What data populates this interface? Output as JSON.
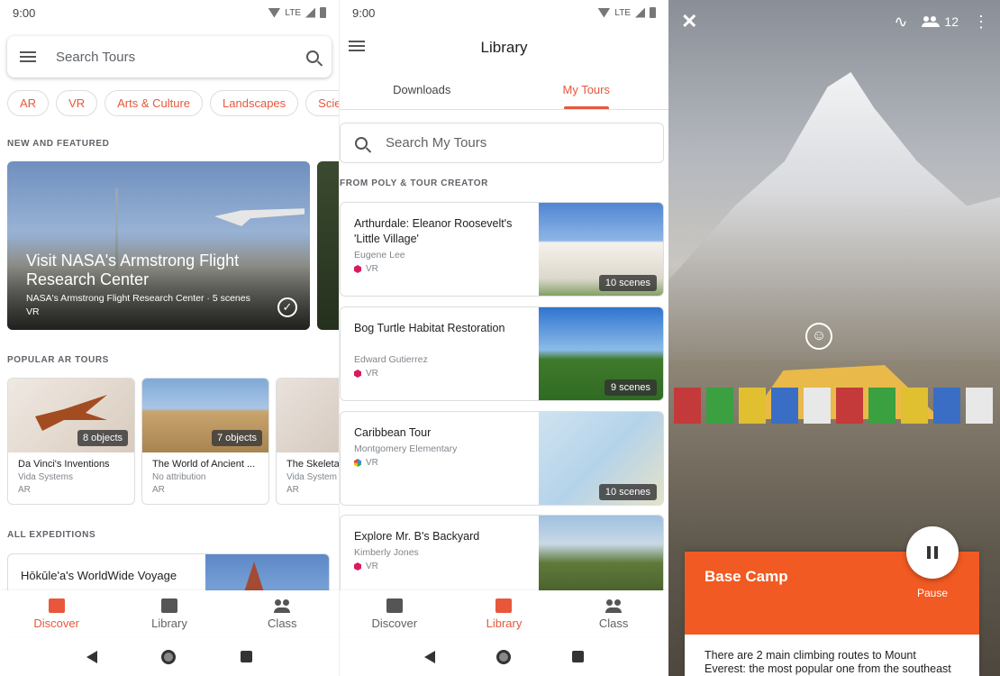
{
  "status": {
    "time": "9:00",
    "network": "LTE"
  },
  "discover": {
    "search_placeholder": "Search Tours",
    "chips": [
      "AR",
      "VR",
      "Arts & Culture",
      "Landscapes",
      "Scien"
    ],
    "new_featured_label": "NEW AND FEATURED",
    "featured": {
      "title": "Visit NASA's Armstrong Flight Research Center",
      "subtitle": "NASA's Armstrong Flight Research Center · 5 scenes",
      "type": "VR"
    },
    "popular_ar_label": "POPULAR AR TOURS",
    "ar_tours": [
      {
        "title": "Da Vinci's Inventions",
        "author": "Vida Systems",
        "type": "AR",
        "count": "8 objects"
      },
      {
        "title": "The World of Ancient ...",
        "author": "No attribution",
        "type": "AR",
        "count": "7 objects"
      },
      {
        "title": "The Skeleta",
        "author": "Vida System",
        "type": "AR",
        "count": ""
      }
    ],
    "all_expeditions_label": "ALL EXPEDITIONS",
    "expedition": {
      "title": "Hōkūle'a's WorldWide Voyage"
    }
  },
  "nav": {
    "discover": "Discover",
    "library": "Library",
    "class": "Class"
  },
  "library": {
    "title": "Library",
    "tabs": [
      "Downloads",
      "My Tours"
    ],
    "search_placeholder": "Search My Tours",
    "section_label": "FROM POLY & TOUR CREATOR",
    "tours": [
      {
        "title": "Arthurdale: Eleanor Roosevelt's 'Little Village'",
        "author": "Eugene Lee",
        "type": "VR",
        "scenes": "10 scenes"
      },
      {
        "title": "Bog Turtle Habitat Restoration",
        "author": "Edward Gutierrez",
        "type": "VR",
        "scenes": "9 scenes"
      },
      {
        "title": "Caribbean Tour",
        "author": "Montgomery Elementary",
        "type": "VR",
        "scenes": "10 scenes"
      },
      {
        "title": "Explore Mr. B's Backyard",
        "author": "Kimberly Jones",
        "type": "VR",
        "scenes": ""
      }
    ]
  },
  "viewer": {
    "participants": "12",
    "scene_title": "Base Camp",
    "pause_label": "Pause",
    "description": "There are 2 main climbing routes to Mount Everest: the most popular one from the southeast"
  },
  "colors": {
    "accent": "#e8573b",
    "card_orange": "#f15a22"
  },
  "icons": [
    "menu-icon",
    "search-icon",
    "check-circle-icon",
    "close-icon",
    "draw-icon",
    "people-icon",
    "more-vert-icon",
    "smiley-icon",
    "pause-icon"
  ]
}
